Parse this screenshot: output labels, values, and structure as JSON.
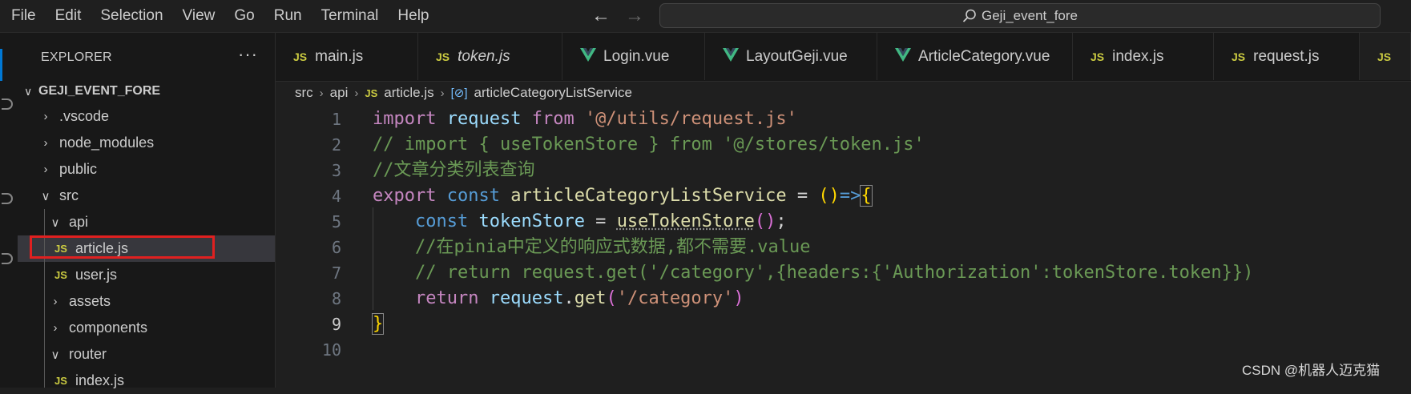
{
  "menu": [
    "File",
    "Edit",
    "Selection",
    "View",
    "Go",
    "Run",
    "Terminal",
    "Help"
  ],
  "search": {
    "text": "Geji_event_fore"
  },
  "explorer": {
    "title": "EXPLORER",
    "project": "GEJI_EVENT_FORE",
    "items": [
      {
        "label": ".vscode",
        "type": "folder",
        "expanded": false
      },
      {
        "label": "node_modules",
        "type": "folder",
        "expanded": false
      },
      {
        "label": "public",
        "type": "folder",
        "expanded": false
      },
      {
        "label": "src",
        "type": "folder",
        "expanded": true
      },
      {
        "label": "api",
        "type": "folder",
        "expanded": true
      },
      {
        "label": "article.js",
        "type": "js",
        "selected": true
      },
      {
        "label": "user.js",
        "type": "js"
      },
      {
        "label": "assets",
        "type": "folder",
        "expanded": false
      },
      {
        "label": "components",
        "type": "folder",
        "expanded": false
      },
      {
        "label": "router",
        "type": "folder",
        "expanded": true
      },
      {
        "label": "index.js",
        "type": "js"
      }
    ]
  },
  "tabs": [
    {
      "label": "main.js",
      "icon": "JS"
    },
    {
      "label": "token.js",
      "icon": "JS",
      "italic": true
    },
    {
      "label": "Login.vue",
      "icon": "vue"
    },
    {
      "label": "LayoutGeji.vue",
      "icon": "vue"
    },
    {
      "label": "ArticleCategory.vue",
      "icon": "vue"
    },
    {
      "label": "index.js",
      "icon": "JS"
    },
    {
      "label": "request.js",
      "icon": "JS"
    },
    {
      "label": "",
      "icon": "JS"
    }
  ],
  "breadcrumb": {
    "src": "src",
    "api": "api",
    "file": "article.js",
    "symbol": "articleCategoryListService"
  },
  "editor": {
    "line_numbers": [
      "1",
      "2",
      "3",
      "4",
      "5",
      "6",
      "7",
      "8",
      "9",
      "10"
    ],
    "active_line": 9,
    "code": {
      "l1_import": "import",
      "l1_request": "request",
      "l1_from": "from",
      "l1_str": "'@/utils/request.js'",
      "l2": "// import { useTokenStore } from '@/stores/token.js'",
      "l3": "//文章分类列表查询",
      "l4_export": "export",
      "l4_const": "const",
      "l4_name": "articleCategoryListService",
      "l4_eq": " = ",
      "l4_parens": "()",
      "l4_arrow": "=>",
      "l4_brace": "{",
      "l5_const": "const",
      "l5_name": "tokenStore",
      "l5_eq": " = ",
      "l5_fn": "useTokenStore",
      "l5_parens": "()",
      "l5_semi": ";",
      "l6": "//在pinia中定义的响应式数据,都不需要.value",
      "l7": "// return request.get('/category',{headers:{'Authorization':tokenStore.token}})",
      "l8_return": "return",
      "l8_obj": "request",
      "l8_dot": ".",
      "l8_fn": "get",
      "l8_open": "(",
      "l8_str": "'/category'",
      "l8_close": ")",
      "l9_brace": "}"
    }
  },
  "watermark": "CSDN @机器人迈克猫",
  "colors": {
    "keyword": "#569cd6",
    "control_keyword": "#c586c0",
    "string": "#ce9178",
    "comment": "#6a9955",
    "variable": "#9cdcfe",
    "function": "#dcdcaa",
    "js_icon": "#cbcb41",
    "vue_icon": "#41b883",
    "selection_box": "#e02020"
  }
}
